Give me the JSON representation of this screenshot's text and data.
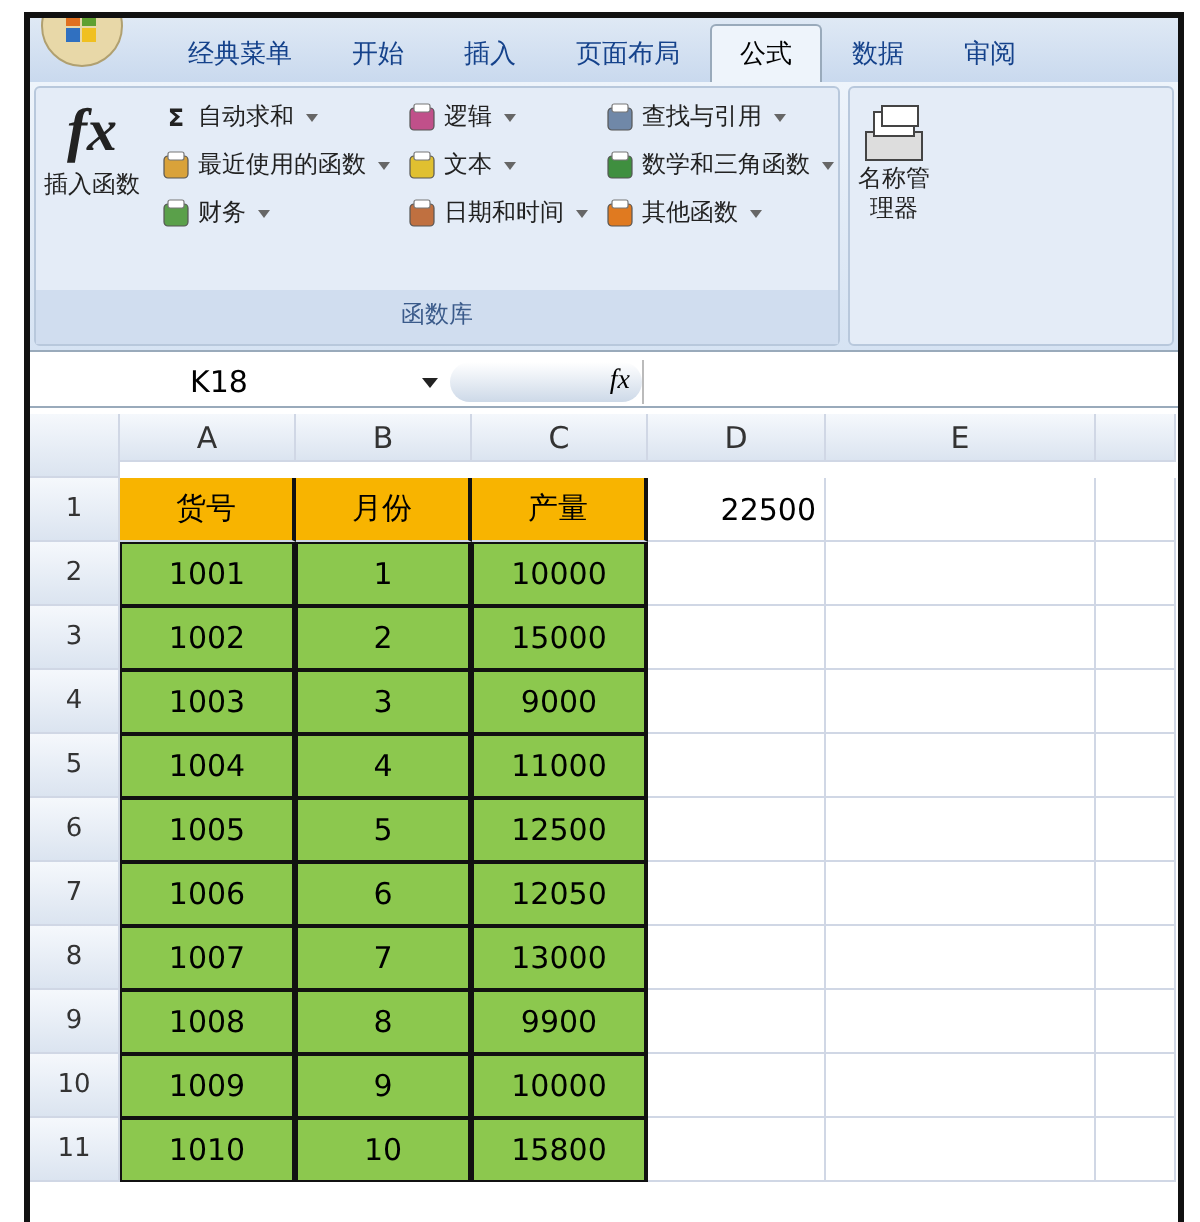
{
  "tabs": [
    {
      "label": "经典菜单",
      "selected": false
    },
    {
      "label": "开始",
      "selected": false
    },
    {
      "label": "插入",
      "selected": false
    },
    {
      "label": "页面布局",
      "selected": false
    },
    {
      "label": "公式",
      "selected": true
    },
    {
      "label": "数据",
      "selected": false
    },
    {
      "label": "审阅",
      "selected": false
    }
  ],
  "ribbon": {
    "insert_function": {
      "symbol": "fx",
      "label": "插入函数"
    },
    "columns": [
      [
        {
          "label": "自动求和",
          "symbol": "Σ",
          "dropdown": true
        },
        {
          "label": "最近使用的函数",
          "dropdown": true
        },
        {
          "label": "财务",
          "dropdown": true
        }
      ],
      [
        {
          "label": "逻辑",
          "dropdown": true
        },
        {
          "label": "文本",
          "dropdown": true
        },
        {
          "label": "日期和时间",
          "dropdown": true
        }
      ],
      [
        {
          "label": "查找与引用",
          "dropdown": true
        },
        {
          "label": "数学和三角函数",
          "dropdown": true
        },
        {
          "label": "其他函数",
          "dropdown": true
        }
      ]
    ],
    "group_label": "函数库",
    "name_manager": {
      "label": "名称管理器"
    }
  },
  "formula_bar": {
    "name_box": "K18",
    "fx": "fx"
  },
  "sheet": {
    "columns": [
      "A",
      "B",
      "C",
      "D",
      "E"
    ],
    "rows": [
      {
        "number": "1",
        "kind": "header",
        "cells": [
          "货号",
          "月份",
          "产量",
          "22500",
          ""
        ]
      },
      {
        "number": "2",
        "kind": "data",
        "cells": [
          "1001",
          "1",
          "10000",
          "",
          ""
        ]
      },
      {
        "number": "3",
        "kind": "data",
        "cells": [
          "1002",
          "2",
          "15000",
          "",
          ""
        ]
      },
      {
        "number": "4",
        "kind": "data",
        "cells": [
          "1003",
          "3",
          "9000",
          "",
          ""
        ]
      },
      {
        "number": "5",
        "kind": "data",
        "cells": [
          "1004",
          "4",
          "11000",
          "",
          ""
        ]
      },
      {
        "number": "6",
        "kind": "data",
        "cells": [
          "1005",
          "5",
          "12500",
          "",
          ""
        ]
      },
      {
        "number": "7",
        "kind": "data",
        "cells": [
          "1006",
          "6",
          "12050",
          "",
          ""
        ]
      },
      {
        "number": "8",
        "kind": "data",
        "cells": [
          "1007",
          "7",
          "13000",
          "",
          ""
        ]
      },
      {
        "number": "9",
        "kind": "data",
        "cells": [
          "1008",
          "8",
          "9900",
          "",
          ""
        ]
      },
      {
        "number": "10",
        "kind": "data",
        "cells": [
          "1009",
          "9",
          "10000",
          "",
          ""
        ]
      },
      {
        "number": "11",
        "kind": "data",
        "cells": [
          "1010",
          "10",
          "15800",
          "",
          ""
        ]
      }
    ]
  }
}
